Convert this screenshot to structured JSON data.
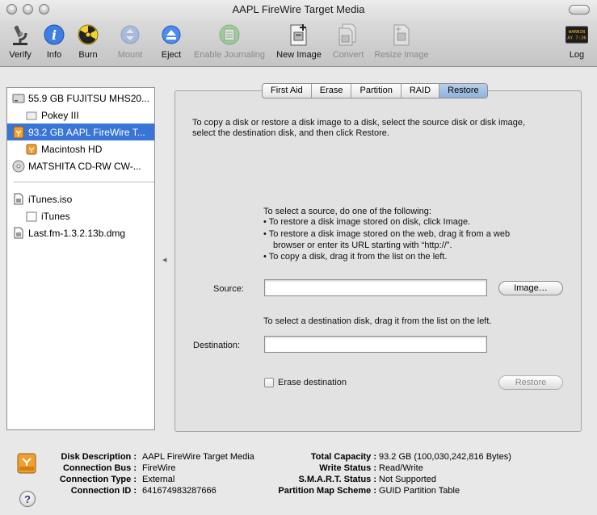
{
  "window": {
    "title": "AAPL FireWire Target Media"
  },
  "toolbar": {
    "items": [
      {
        "label": "Verify",
        "icon": "microscope-icon",
        "enabled": true
      },
      {
        "label": "Info",
        "icon": "info-icon",
        "enabled": true
      },
      {
        "label": "Burn",
        "icon": "burn-icon",
        "enabled": true
      },
      {
        "label": "Mount",
        "icon": "mount-icon",
        "enabled": false
      },
      {
        "label": "Eject",
        "icon": "eject-icon",
        "enabled": true
      },
      {
        "label": "Enable Journaling",
        "icon": "journal-icon",
        "enabled": false
      },
      {
        "label": "New Image",
        "icon": "new-image-icon",
        "enabled": true
      },
      {
        "label": "Convert",
        "icon": "convert-icon",
        "enabled": false
      },
      {
        "label": "Resize Image",
        "icon": "resize-image-icon",
        "enabled": false
      },
      {
        "label": "Log",
        "icon": "log-icon",
        "enabled": true,
        "icon_text": "WARNIN\nAY 7:36"
      }
    ]
  },
  "sidebar": {
    "items": [
      {
        "label": "55.9 GB FUJITSU MHS20...",
        "icon": "hard-disk-icon",
        "indent": 0,
        "selected": false
      },
      {
        "label": "Pokey III",
        "icon": "volume-icon",
        "indent": 1,
        "selected": false
      },
      {
        "label": "93.2 GB AAPL FireWire T...",
        "icon": "firewire-disk-icon",
        "indent": 0,
        "selected": true
      },
      {
        "label": "Macintosh HD",
        "icon": "firewire-volume-icon",
        "indent": 1,
        "selected": false
      },
      {
        "label": "MATSHITA CD-RW CW-...",
        "icon": "optical-drive-icon",
        "indent": 0,
        "selected": false
      },
      {
        "label": "iTunes.iso",
        "icon": "disk-image-icon",
        "indent": 0,
        "selected": false
      },
      {
        "label": "iTunes",
        "icon": "mounted-image-icon",
        "indent": 1,
        "selected": false
      },
      {
        "label": "Last.fm-1.3.2.13b.dmg",
        "icon": "disk-image-icon",
        "indent": 0,
        "selected": false
      }
    ]
  },
  "tabs": [
    {
      "label": "First Aid",
      "active": false
    },
    {
      "label": "Erase",
      "active": false
    },
    {
      "label": "Partition",
      "active": false
    },
    {
      "label": "RAID",
      "active": false
    },
    {
      "label": "Restore",
      "active": true
    }
  ],
  "restore": {
    "intro_line1": "To copy a disk or restore a disk image to a disk, select the source disk or disk image,",
    "intro_line2": "select the destination disk, and then click Restore.",
    "source_heading": "To select a source, do one of the following:",
    "bullet1": "• To restore a disk image stored on disk, click Image.",
    "bullet2a": "• To restore a disk image stored on the web, drag it from a web",
    "bullet2b": "browser or enter its URL starting with “http://”.",
    "bullet3": "• To copy a disk, drag it from the list on the left.",
    "source_label": "Source:",
    "source_value": "",
    "image_button": "Image…",
    "destination_hint": "To select a destination disk, drag it from the list on the left.",
    "destination_label": "Destination:",
    "destination_value": "",
    "erase_label": "Erase destination",
    "erase_checked": false,
    "restore_button": "Restore"
  },
  "info": {
    "left": [
      {
        "key": "Disk Description :",
        "value": "AAPL FireWire Target Media"
      },
      {
        "key": "Connection Bus :",
        "value": "FireWire"
      },
      {
        "key": "Connection Type :",
        "value": "External"
      },
      {
        "key": "Connection ID :",
        "value": "641674983287666"
      }
    ],
    "right": [
      {
        "key": "Total Capacity :",
        "value": "93.2 GB (100,030,242,816 Bytes)"
      },
      {
        "key": "Write Status :",
        "value": "Read/Write"
      },
      {
        "key": "S.M.A.R.T. Status :",
        "value": "Not Supported"
      },
      {
        "key": "Partition Map Scheme :",
        "value": "GUID Partition Table"
      }
    ],
    "help_icon_text": "?"
  },
  "colors": {
    "selection": "#3875d7",
    "firewire_orange": "#f0a030"
  }
}
